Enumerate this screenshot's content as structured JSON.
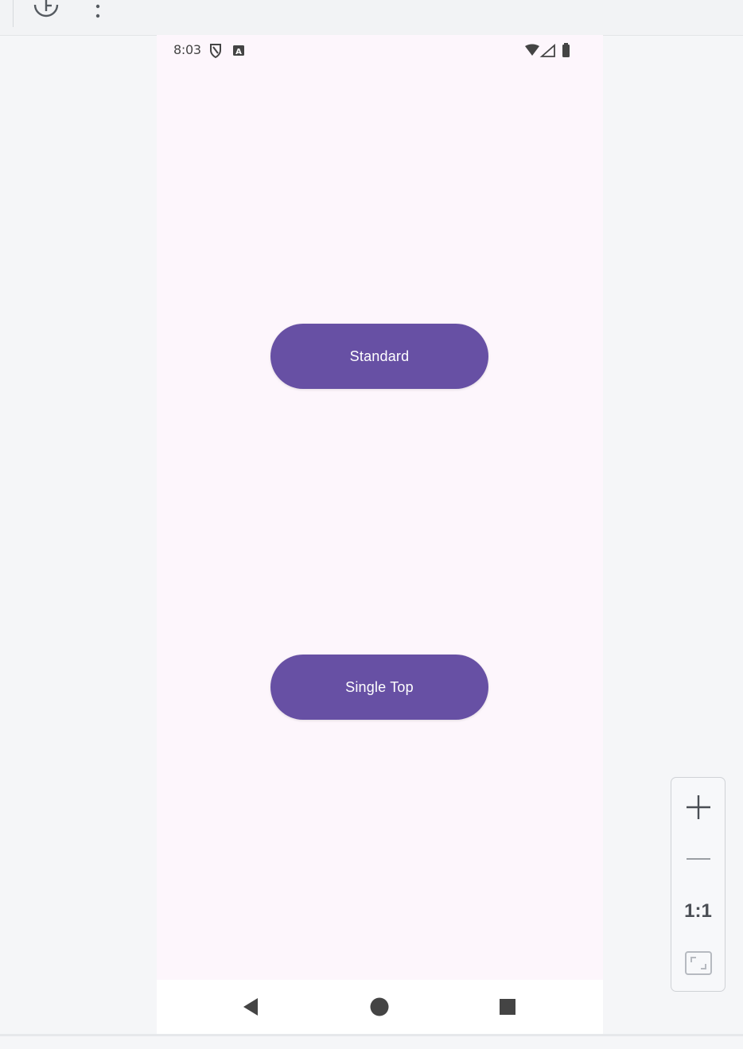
{
  "toolbar": {
    "icons": [
      "history-icon",
      "more-vert-icon"
    ]
  },
  "device": {
    "statusbar": {
      "time": "8:03",
      "left_icons": [
        "shield-icon",
        "notification-a-icon"
      ],
      "right_icons": [
        "wifi-icon",
        "signal-icon",
        "battery-icon"
      ]
    },
    "buttons": {
      "standard": "Standard",
      "single_top": "Single Top"
    },
    "colors": {
      "screen_bg": "#fdf6fc",
      "button_bg": "#6750a4",
      "button_text": "#ffffff"
    },
    "navbar": {
      "icons": [
        "back-icon",
        "home-icon",
        "recents-icon"
      ]
    }
  },
  "zoom_controls": {
    "zoom_in_icon": "plus-icon",
    "zoom_out_icon": "minus-icon",
    "ratio_label": "1:1",
    "fit_icon": "fit-screen-icon"
  }
}
